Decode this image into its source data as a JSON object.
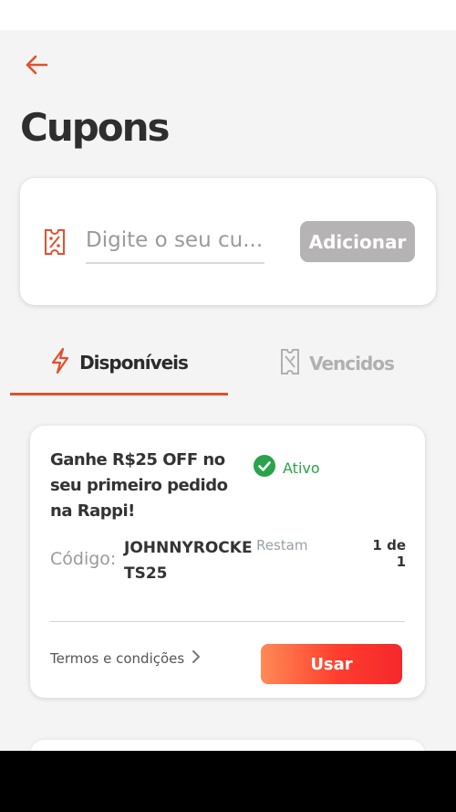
{
  "header": {
    "back_icon": "arrow-left-icon",
    "title": "Cupons"
  },
  "coupon_input": {
    "icon": "coupon-ticket-icon",
    "value": "",
    "placeholder": "Digite o seu cu...",
    "add_label": "Adicionar"
  },
  "tabs": [
    {
      "label": "Disponíveis",
      "icon": "lightning-icon",
      "active": true
    },
    {
      "label": "Vencidos",
      "icon": "expired-ticket-icon",
      "active": false
    }
  ],
  "coupons": [
    {
      "title": "Ganhe R$25 OFF no seu primeiro pedido na Rappi!",
      "status": "Ativo",
      "status_icon": "check-circle-icon",
      "code_label": "Código:",
      "code": "JOHNNYROCKETS25",
      "remaining_label": "Restam",
      "remaining_value": "1 de 1",
      "terms_label": "Termos e condições",
      "use_label": "Usar"
    }
  ],
  "colors": {
    "accent": "#e3502d",
    "success": "#2aa34b",
    "disabled_button": "#b5b3b3",
    "background": "#f4f4f4",
    "use_gradient_start": "#ff8a55",
    "use_gradient_end": "#f4282b"
  }
}
